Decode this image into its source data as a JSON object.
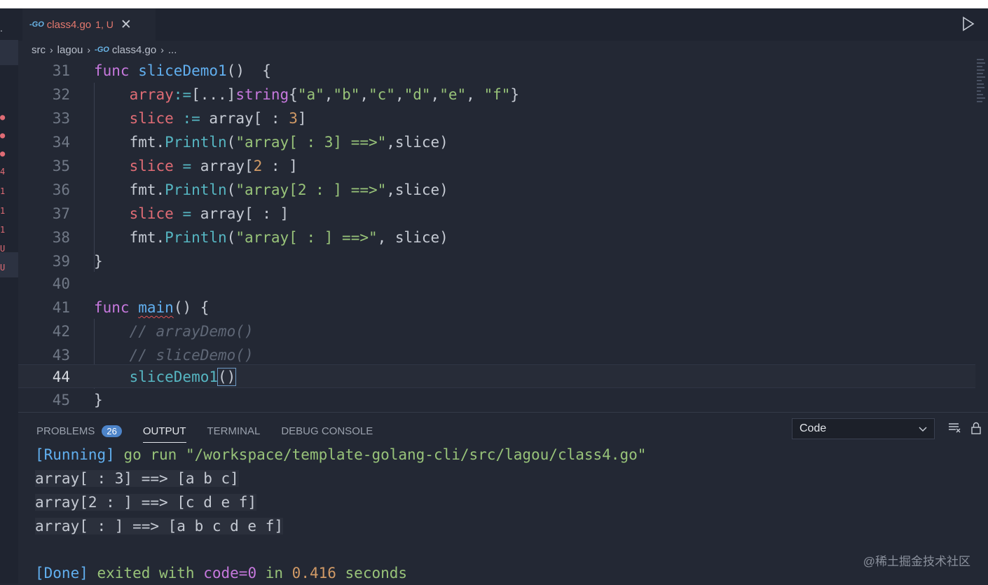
{
  "tab": {
    "icon": "go-file-icon",
    "filename": "class4.go",
    "status": "1, U"
  },
  "breadcrumb": {
    "parts": [
      "src",
      "lagou",
      "class4.go",
      "..."
    ]
  },
  "editor": {
    "lines": [
      {
        "n": "31"
      },
      {
        "n": "32"
      },
      {
        "n": "33"
      },
      {
        "n": "34"
      },
      {
        "n": "35"
      },
      {
        "n": "36"
      },
      {
        "n": "37"
      },
      {
        "n": "38"
      },
      {
        "n": "39"
      },
      {
        "n": "40"
      },
      {
        "n": "41"
      },
      {
        "n": "42"
      },
      {
        "n": "43"
      },
      {
        "n": "44"
      },
      {
        "n": "45"
      }
    ],
    "current_line": "44"
  },
  "sidebar_markers": [
    ".",
    "4",
    "1",
    "1",
    "1",
    "U",
    "U"
  ],
  "panel": {
    "tabs": {
      "problems": "PROBLEMS",
      "problems_count": "26",
      "output": "OUTPUT",
      "terminal": "TERMINAL",
      "debug": "DEBUG CONSOLE"
    },
    "select_value": "Code",
    "output_lines": {
      "running_tag": "[Running]",
      "running_cmd": " go run \"/workspace/template-golang-cli/src/lagou/class4.go\"",
      "line1": "array[ : 3] ==> [a b c]",
      "line2": "array[2 : ] ==> [c d e f]",
      "line3": "array[ : ] ==> [a b c d e f]",
      "done_tag": "[Done]",
      "done_exited": " exited with ",
      "done_code": "code=0",
      "done_in": " in ",
      "done_secs": "0.416",
      "done_seconds": " seconds"
    }
  },
  "watermark": "@稀土掘金技术社区",
  "colors": {
    "accent": "#4d84c9",
    "modified": "#e5796e"
  }
}
